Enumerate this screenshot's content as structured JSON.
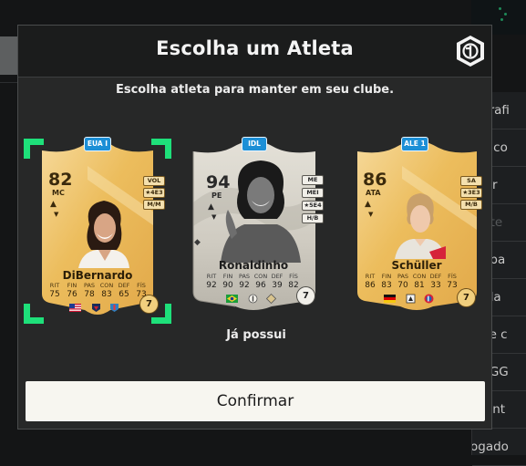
{
  "modal": {
    "title": "Escolha um Atleta",
    "subtitle": "Escolha atleta para manter em seu clube.",
    "owned_label": "Já possui",
    "confirm_label": "Confirmar"
  },
  "side_menu": {
    "items": [
      {
        "label": "iografi"
      },
      {
        "label": "sar co"
      },
      {
        "label": "ocar"
      },
      {
        "label": "te ite"
      },
      {
        "label": "ompa"
      },
      {
        "label": "enda"
      },
      {
        "label": "opie c"
      },
      {
        "label": "UT.GG"
      },
      {
        "label": "ncont"
      },
      {
        "label": "ogado"
      }
    ]
  },
  "cards": [
    {
      "name": "DiBernardo",
      "rating": "82",
      "position": "MC",
      "badge": "EUA I",
      "tags": [
        "VOL",
        "★4E3",
        "M/M"
      ],
      "stat_labels": [
        "RIT",
        "FIN",
        "PAS",
        "CON",
        "DEF",
        "FÍS"
      ],
      "stat_values": [
        "75",
        "76",
        "78",
        "83",
        "65",
        "73"
      ],
      "chemistry": "7",
      "selected": true,
      "icons": [
        "us-flag-icon",
        "league-crest-icon",
        "club-crest-icon"
      ]
    },
    {
      "name": "Ronaldinho",
      "rating": "94",
      "position": "PE",
      "badge": "IDL",
      "tags": [
        "ME",
        "MEI",
        "★5E4",
        "H/B"
      ],
      "stat_labels": [
        "RIT",
        "FIN",
        "PAS",
        "CON",
        "DEF",
        "FÍS"
      ],
      "stat_values": [
        "92",
        "90",
        "92",
        "96",
        "39",
        "82"
      ],
      "chemistry": "7",
      "selected": false,
      "icons": [
        "brazil-flag-icon",
        "icons-league-icon",
        "icons-club-icon"
      ]
    },
    {
      "name": "Schüller",
      "rating": "86",
      "position": "ATA",
      "badge": "ALE 1",
      "tags": [
        "SA",
        "★3E3",
        "M/B"
      ],
      "stat_labels": [
        "RIT",
        "FIN",
        "PAS",
        "CON",
        "DEF",
        "FÍS"
      ],
      "stat_values": [
        "86",
        "83",
        "70",
        "81",
        "33",
        "73"
      ],
      "chemistry": "7",
      "selected": false,
      "icons": [
        "germany-flag-icon",
        "league-crest-icon",
        "bayern-crest-icon"
      ]
    }
  ],
  "colors": {
    "gold_card": "#efc263",
    "icon_card": "#dcd8cf",
    "selection_frame": "#1ee07a",
    "badge_blue": "#1c8fd6",
    "confirm_bg": "#f7f6f0"
  }
}
